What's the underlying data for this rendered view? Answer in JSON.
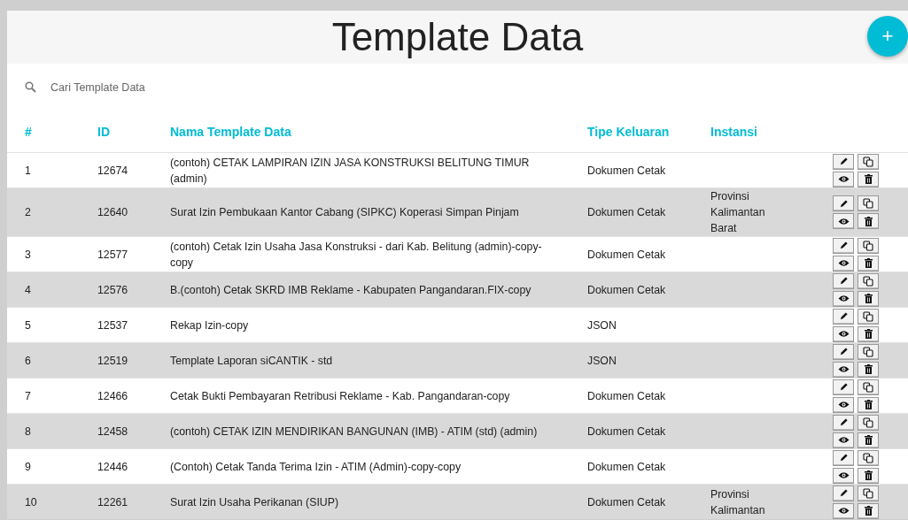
{
  "header": {
    "title": "Template Data",
    "add_button": "+"
  },
  "search": {
    "placeholder": "Cari Template Data"
  },
  "table": {
    "columns": [
      "#",
      "ID",
      "Nama Template Data",
      "Tipe Keluaran",
      "Instansi"
    ],
    "rows": [
      {
        "number": "1",
        "id": "12674",
        "name": "(contoh) CETAK LAMPIRAN IZIN JASA KONSTRUKSI BELITUNG TIMUR (admin)",
        "output_type": "Dokumen Cetak"
      },
      {
        "number": "2",
        "id": "12640",
        "name": "Surat Izin Pembukaan Kantor Cabang (SIPKC) Koperasi Simpan Pinjam",
        "output_type": "Dokumen Cetak",
        "agency": "Provinsi Kalimantan Barat"
      },
      {
        "number": "3",
        "id": "12577",
        "name": "(contoh) Cetak Izin Usaha Jasa Konstruksi - dari Kab. Belitung (admin)-copy-copy",
        "output_type": "Dokumen Cetak"
      },
      {
        "number": "4",
        "id": "12576",
        "name": "B.(contoh) Cetak SKRD IMB Reklame - Kabupaten Pangandaran.FIX-copy",
        "output_type": "Dokumen Cetak"
      },
      {
        "number": "5",
        "id": "12537",
        "name": "Rekap Izin-copy",
        "output_type": "JSON"
      },
      {
        "number": "6",
        "id": "12519",
        "name": "Template Laporan siCANTIK - std",
        "output_type": "JSON"
      },
      {
        "number": "7",
        "id": "12466",
        "name": "Cetak Bukti Pembayaran Retribusi Reklame - Kab. Pangandaran-copy",
        "output_type": "Dokumen Cetak"
      },
      {
        "number": "8",
        "id": "12458",
        "name": "(contoh) CETAK IZIN MENDIRIKAN BANGUNAN (IMB) - ATIM (std) (admin)",
        "output_type": "Dokumen Cetak"
      },
      {
        "number": "9",
        "id": "12446",
        "name": "(Contoh) Cetak Tanda Terima Izin - ATIM (Admin)-copy-copy",
        "output_type": "Dokumen Cetak"
      },
      {
        "number": "10",
        "id": "12261",
        "name": "Surat Izin Usaha Perikanan (SIUP)",
        "output_type": "Dokumen Cetak",
        "agency": "Provinsi Kalimantan"
      }
    ]
  }
}
